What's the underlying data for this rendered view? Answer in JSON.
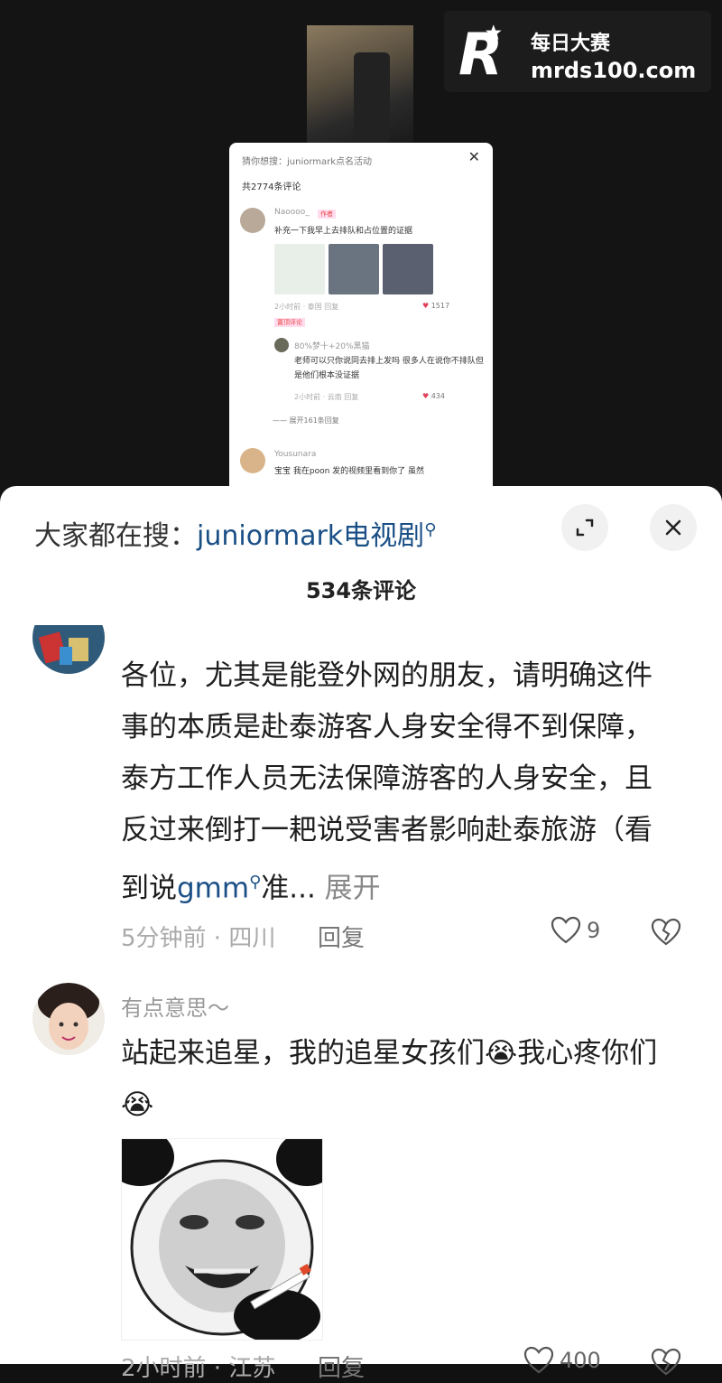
{
  "watermark": {
    "line1": "每日大赛",
    "line2": "mrds100.com"
  },
  "inner_card": {
    "title": "猜你想搜：juniormark点名活动",
    "close": "✕",
    "count": "共2774条评论",
    "c1_name": "Naoooo_",
    "c1_tag": "作者",
    "c1_text": "补充一下我早上去排队和占位置的证据",
    "c1_meta": "2小时前 · 泰国   回复",
    "c1_likes": "1517",
    "c1_badge": "置顶评论",
    "r1_name": "80%梦十+20%黑猫",
    "r1_text": "老师可以只你说同去排上发吗 很多人在说你不排队但是他们根本没证据",
    "r1_meta": "2小时前 · 云南   回复",
    "r1_likes": "434",
    "expand": "—— 展开161条回复",
    "c2_name": "Yousunara",
    "c2_text": "宝宝 我在poon 发的视频里看到你了 虽然"
  },
  "sheet": {
    "search_prefix": "大家都在搜：",
    "search_term": "juniormark电视剧",
    "comment_count": "534条评论",
    "comment1": {
      "text_a": "各位，尤其是能登外网的朋友，请明确这件事的本质是赴泰游客人身安全得不到保障，泰方工作人员无法保障游客的人身安全，且反过来倒打一耙说受害者影响赴泰旅游（看到说",
      "highlight": "gmm",
      "text_b": "准...",
      "more": " 展开",
      "meta": "5分钟前 · 四川",
      "reply": "回复",
      "likes": "9"
    },
    "comment2": {
      "name": "有点意思～",
      "text": "站起来追星，我的追星女孩们😭我心疼你们😭",
      "meta": "2小时前 · 江苏",
      "reply": "回复",
      "likes": "400"
    }
  },
  "colors": {
    "link": "#1a4f86",
    "accent_red": "#e0405a"
  }
}
